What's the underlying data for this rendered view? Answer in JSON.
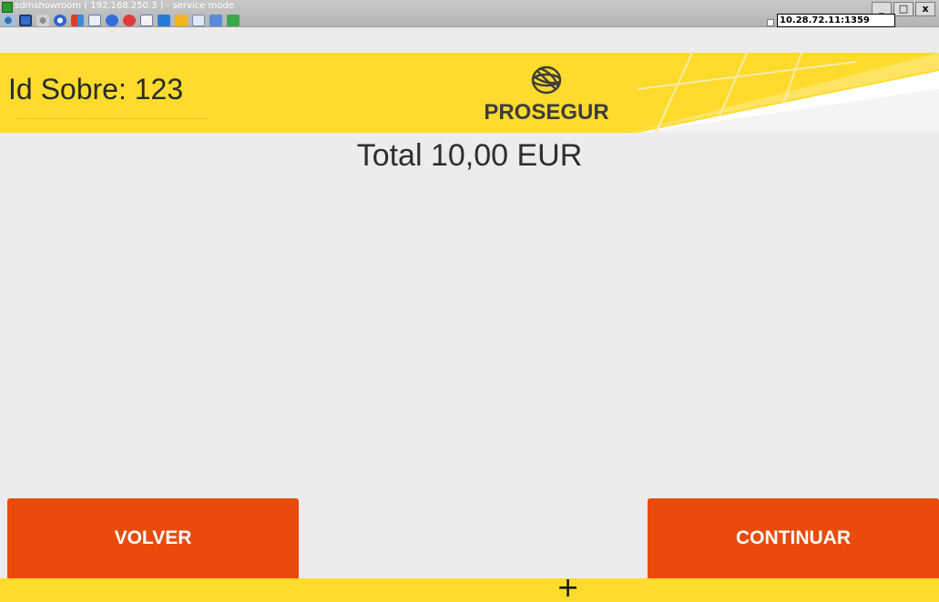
{
  "window": {
    "title": "sdmshowroom ( 192.168.250.3 ) - service mode",
    "minimize_label": "_",
    "maximize_label": "□",
    "close_label": "x",
    "connection": "10.28.72.11:1359"
  },
  "toolbar": {
    "icons": [
      "settings-icon",
      "capture-icon",
      "gear-icon",
      "refresh-icon",
      "windows-icon",
      "window-icon",
      "info-icon",
      "stop-icon",
      "document-icon",
      "monitor-icon",
      "folder-icon",
      "screen-icon",
      "chat-icon",
      "message-icon"
    ]
  },
  "header": {
    "envelope_id": "Id Sobre: 123",
    "brand": "PROSEGUR"
  },
  "main": {
    "total": "Total 10,00 EUR"
  },
  "buttons": {
    "back": "VOLVER",
    "continue": "CONTINUAR"
  },
  "footer": {
    "cursor_glyph": "+"
  },
  "colors": {
    "brand_yellow": "#fedb2c",
    "button_orange": "#e94b0c",
    "background": "#ececec"
  }
}
